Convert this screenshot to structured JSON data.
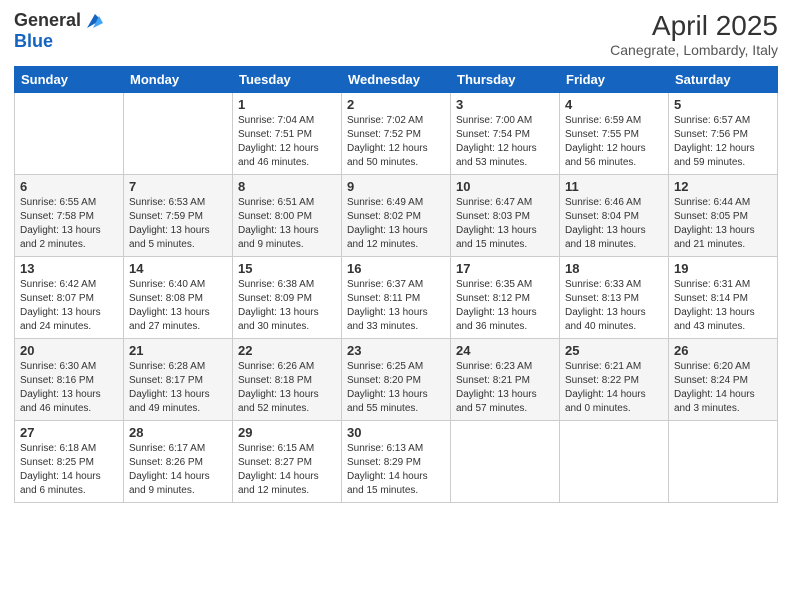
{
  "header": {
    "logo_line1": "General",
    "logo_line2": "Blue",
    "month_year": "April 2025",
    "location": "Canegrate, Lombardy, Italy"
  },
  "days_of_week": [
    "Sunday",
    "Monday",
    "Tuesday",
    "Wednesday",
    "Thursday",
    "Friday",
    "Saturday"
  ],
  "weeks": [
    [
      {
        "day": "",
        "info": ""
      },
      {
        "day": "",
        "info": ""
      },
      {
        "day": "1",
        "info": "Sunrise: 7:04 AM\nSunset: 7:51 PM\nDaylight: 12 hours\nand 46 minutes."
      },
      {
        "day": "2",
        "info": "Sunrise: 7:02 AM\nSunset: 7:52 PM\nDaylight: 12 hours\nand 50 minutes."
      },
      {
        "day": "3",
        "info": "Sunrise: 7:00 AM\nSunset: 7:54 PM\nDaylight: 12 hours\nand 53 minutes."
      },
      {
        "day": "4",
        "info": "Sunrise: 6:59 AM\nSunset: 7:55 PM\nDaylight: 12 hours\nand 56 minutes."
      },
      {
        "day": "5",
        "info": "Sunrise: 6:57 AM\nSunset: 7:56 PM\nDaylight: 12 hours\nand 59 minutes."
      }
    ],
    [
      {
        "day": "6",
        "info": "Sunrise: 6:55 AM\nSunset: 7:58 PM\nDaylight: 13 hours\nand 2 minutes."
      },
      {
        "day": "7",
        "info": "Sunrise: 6:53 AM\nSunset: 7:59 PM\nDaylight: 13 hours\nand 5 minutes."
      },
      {
        "day": "8",
        "info": "Sunrise: 6:51 AM\nSunset: 8:00 PM\nDaylight: 13 hours\nand 9 minutes."
      },
      {
        "day": "9",
        "info": "Sunrise: 6:49 AM\nSunset: 8:02 PM\nDaylight: 13 hours\nand 12 minutes."
      },
      {
        "day": "10",
        "info": "Sunrise: 6:47 AM\nSunset: 8:03 PM\nDaylight: 13 hours\nand 15 minutes."
      },
      {
        "day": "11",
        "info": "Sunrise: 6:46 AM\nSunset: 8:04 PM\nDaylight: 13 hours\nand 18 minutes."
      },
      {
        "day": "12",
        "info": "Sunrise: 6:44 AM\nSunset: 8:05 PM\nDaylight: 13 hours\nand 21 minutes."
      }
    ],
    [
      {
        "day": "13",
        "info": "Sunrise: 6:42 AM\nSunset: 8:07 PM\nDaylight: 13 hours\nand 24 minutes."
      },
      {
        "day": "14",
        "info": "Sunrise: 6:40 AM\nSunset: 8:08 PM\nDaylight: 13 hours\nand 27 minutes."
      },
      {
        "day": "15",
        "info": "Sunrise: 6:38 AM\nSunset: 8:09 PM\nDaylight: 13 hours\nand 30 minutes."
      },
      {
        "day": "16",
        "info": "Sunrise: 6:37 AM\nSunset: 8:11 PM\nDaylight: 13 hours\nand 33 minutes."
      },
      {
        "day": "17",
        "info": "Sunrise: 6:35 AM\nSunset: 8:12 PM\nDaylight: 13 hours\nand 36 minutes."
      },
      {
        "day": "18",
        "info": "Sunrise: 6:33 AM\nSunset: 8:13 PM\nDaylight: 13 hours\nand 40 minutes."
      },
      {
        "day": "19",
        "info": "Sunrise: 6:31 AM\nSunset: 8:14 PM\nDaylight: 13 hours\nand 43 minutes."
      }
    ],
    [
      {
        "day": "20",
        "info": "Sunrise: 6:30 AM\nSunset: 8:16 PM\nDaylight: 13 hours\nand 46 minutes."
      },
      {
        "day": "21",
        "info": "Sunrise: 6:28 AM\nSunset: 8:17 PM\nDaylight: 13 hours\nand 49 minutes."
      },
      {
        "day": "22",
        "info": "Sunrise: 6:26 AM\nSunset: 8:18 PM\nDaylight: 13 hours\nand 52 minutes."
      },
      {
        "day": "23",
        "info": "Sunrise: 6:25 AM\nSunset: 8:20 PM\nDaylight: 13 hours\nand 55 minutes."
      },
      {
        "day": "24",
        "info": "Sunrise: 6:23 AM\nSunset: 8:21 PM\nDaylight: 13 hours\nand 57 minutes."
      },
      {
        "day": "25",
        "info": "Sunrise: 6:21 AM\nSunset: 8:22 PM\nDaylight: 14 hours\nand 0 minutes."
      },
      {
        "day": "26",
        "info": "Sunrise: 6:20 AM\nSunset: 8:24 PM\nDaylight: 14 hours\nand 3 minutes."
      }
    ],
    [
      {
        "day": "27",
        "info": "Sunrise: 6:18 AM\nSunset: 8:25 PM\nDaylight: 14 hours\nand 6 minutes."
      },
      {
        "day": "28",
        "info": "Sunrise: 6:17 AM\nSunset: 8:26 PM\nDaylight: 14 hours\nand 9 minutes."
      },
      {
        "day": "29",
        "info": "Sunrise: 6:15 AM\nSunset: 8:27 PM\nDaylight: 14 hours\nand 12 minutes."
      },
      {
        "day": "30",
        "info": "Sunrise: 6:13 AM\nSunset: 8:29 PM\nDaylight: 14 hours\nand 15 minutes."
      },
      {
        "day": "",
        "info": ""
      },
      {
        "day": "",
        "info": ""
      },
      {
        "day": "",
        "info": ""
      }
    ]
  ]
}
